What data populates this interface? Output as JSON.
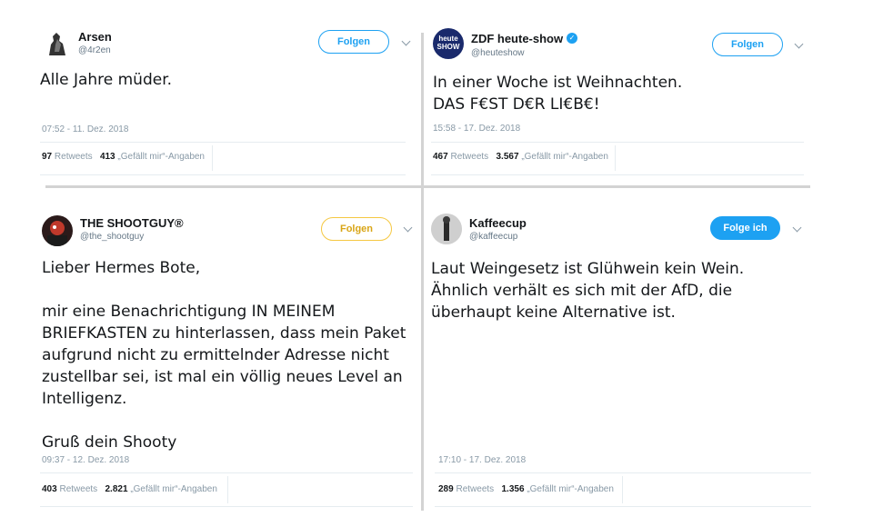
{
  "tweets": [
    {
      "name": "Arsen",
      "handle": "@4r2en",
      "follow_label": "Folgen",
      "text": "Alle Jahre müder.",
      "time": "07:52 - 11. Dez. 2018",
      "retweets_count": "97",
      "retweets_label": "Retweets",
      "likes_count": "413",
      "likes_label": "„Gefällt mir“-Angaben"
    },
    {
      "name": "ZDF heute-show",
      "handle": "@heuteshow",
      "follow_label": "Folgen",
      "text": "In einer Woche ist Weihnachten.\nDAS F€ST D€R LI€B€!",
      "time": "15:58 - 17. Dez. 2018",
      "retweets_count": "467",
      "retweets_label": "Retweets",
      "likes_count": "3.567",
      "likes_label": "„Gefällt mir“-Angaben",
      "avatar_text": "heute\nSHOW"
    },
    {
      "name": "THE SHOOTGUY®",
      "handle": "@the_shootguy",
      "follow_label": "Folgen",
      "text": "Lieber Hermes Bote,\n\nmir eine Benachrichtigung IN MEINEM BRIEFKASTEN zu hinterlassen, dass mein Paket aufgrund nicht zu ermittelnder Adresse nicht zustellbar sei, ist mal ein völlig neues Level an Intelligenz.\n\nGruß dein Shooty",
      "time": "09:37 - 12. Dez. 2018",
      "retweets_count": "403",
      "retweets_label": "Retweets",
      "likes_count": "2.821",
      "likes_label": "„Gefällt mir“-Angaben"
    },
    {
      "name": "Kaffeecup",
      "handle": "@kaffeecup",
      "follow_label": "Folge ich",
      "text": "Laut Weingesetz ist Glühwein kein Wein.\nÄhnlich verhält es sich mit der AfD, die überhaupt keine Alternative ist.",
      "time": "17:10 - 17. Dez. 2018",
      "retweets_count": "289",
      "retweets_label": "Retweets",
      "likes_count": "1.356",
      "likes_label": "„Gefällt mir“-Angaben"
    }
  ],
  "colors": {
    "accent": "#1da1f2",
    "follow_yellow": "#f5c842",
    "meta_gray": "#8899a6"
  },
  "icons": {
    "verified": "verified-badge-icon",
    "more": "chevron-down-icon"
  }
}
